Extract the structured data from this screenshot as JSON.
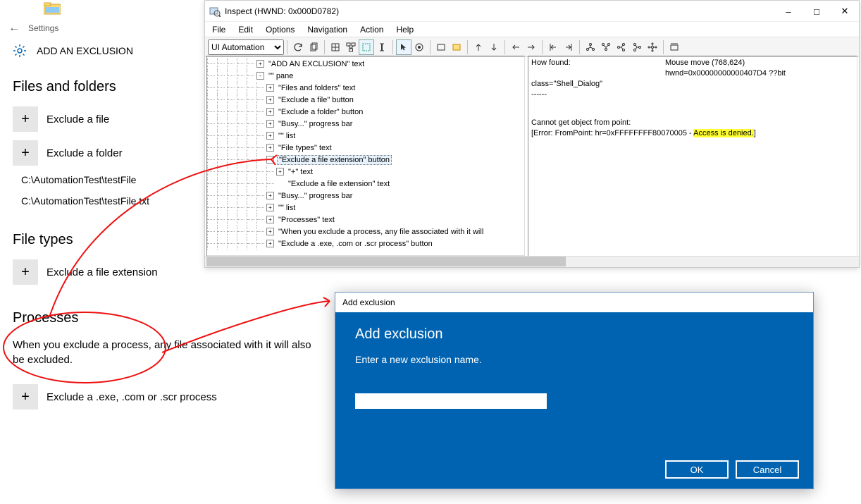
{
  "settings": {
    "header_label": "Settings",
    "page_title": "ADD AN EXCLUSION",
    "sections": {
      "files_folders": {
        "title": "Files and folders",
        "exclude_file": "Exclude a file",
        "exclude_folder": "Exclude a folder",
        "existing1": "C:\\AutomationTest\\testFile",
        "existing2": "C:\\AutomationTest\\testFile.txt"
      },
      "file_types": {
        "title": "File types",
        "exclude_ext": "Exclude a file extension"
      },
      "processes": {
        "title": "Processes",
        "desc": "When you exclude a process, any file associated with it will also be excluded.",
        "exclude_proc": "Exclude a .exe, .com or .scr process"
      }
    }
  },
  "inspect": {
    "title": "Inspect  (HWND: 0x000D0782)",
    "menu": [
      "File",
      "Edit",
      "Options",
      "Navigation",
      "Action",
      "Help"
    ],
    "automation_mode": "UI Automation",
    "tree": [
      {
        "indent": 5,
        "exp": "+",
        "label": "\"ADD AN EXCLUSION\" text"
      },
      {
        "indent": 5,
        "exp": "-",
        "label": "\"\" pane"
      },
      {
        "indent": 6,
        "exp": "+",
        "label": "\"Files and folders\" text"
      },
      {
        "indent": 6,
        "exp": "+",
        "label": "\"Exclude a file\" button"
      },
      {
        "indent": 6,
        "exp": "+",
        "label": "\"Exclude a folder\" button"
      },
      {
        "indent": 6,
        "exp": "+",
        "label": "\"Busy...\" progress bar"
      },
      {
        "indent": 6,
        "exp": "+",
        "label": "\"\" list"
      },
      {
        "indent": 6,
        "exp": "+",
        "label": "\"File types\" text"
      },
      {
        "indent": 6,
        "exp": "-",
        "label": "\"Exclude a file extension\" button",
        "selected": true
      },
      {
        "indent": 7,
        "exp": "+",
        "label": "\"+\" text"
      },
      {
        "indent": 7,
        "exp": "",
        "label": "\"Exclude a file extension\" text"
      },
      {
        "indent": 6,
        "exp": "+",
        "label": "\"Busy...\" progress bar"
      },
      {
        "indent": 6,
        "exp": "+",
        "label": "\"\" list"
      },
      {
        "indent": 6,
        "exp": "+",
        "label": "\"Processes\" text"
      },
      {
        "indent": 6,
        "exp": "+",
        "label": "\"When you exclude a process, any file associated with it will"
      },
      {
        "indent": 6,
        "exp": "+",
        "label": "\"Exclude a .exe, .com or .scr process\" button"
      }
    ],
    "info": {
      "how_found_label": "How found:",
      "how_found_val1": "Mouse move (768,624)",
      "how_found_val2": "hwnd=0x00000000000407D4 ??bit class=\"Shell_Dialog\"",
      "dashes": "------",
      "err1": "Cannot get object from point:",
      "err2_pre": "[Error: FromPoint: hr=0xFFFFFFFF80070005 - ",
      "err2_hl": "Access is denied.",
      "err2_post": "]"
    }
  },
  "dialog": {
    "titlebar": "Add exclusion",
    "heading": "Add exclusion",
    "sub": "Enter a new exclusion name.",
    "input_value": "",
    "ok": "OK",
    "cancel": "Cancel"
  }
}
